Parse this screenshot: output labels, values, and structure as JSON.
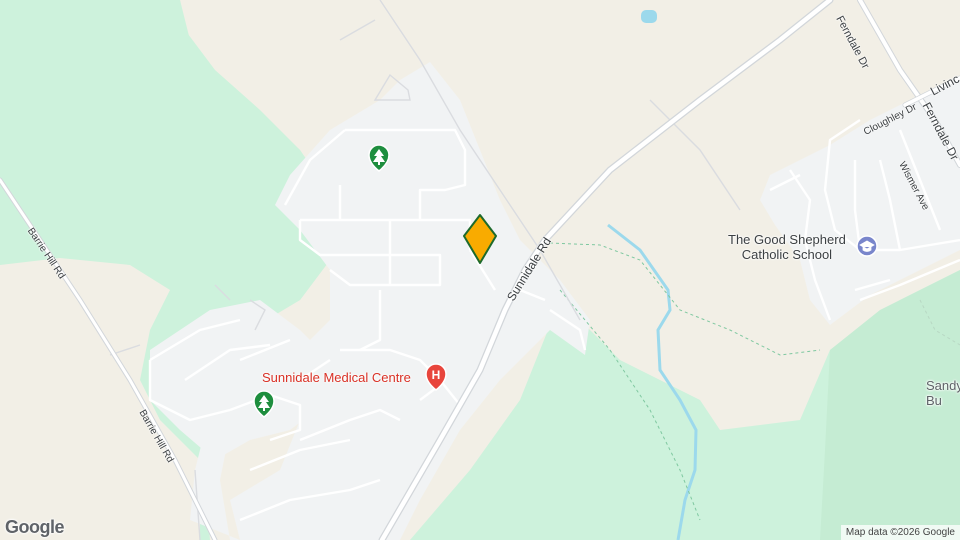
{
  "map": {
    "roads": {
      "ferndale_dr": "Ferndale Dr",
      "livingstone": "Livinc",
      "cloughley_dr": "Cloughley Dr",
      "wismer_ave": "Wismer Ave",
      "sunnidale_rd": "Sunnidale Rd",
      "barrie_hill_rd_top": "Barrie Hill Rd",
      "barrie_hill_rd_bottom": "Barrie Hill Rd"
    },
    "pois": {
      "school": "The Good Shepherd\nCatholic School",
      "medical": "Sunnidale Medical Centre",
      "sandy": "Sandy\nBu"
    },
    "icons": {
      "park_1": "tree-icon",
      "park_2": "tree-icon",
      "hospital": "hospital-icon",
      "school": "graduation-cap-icon",
      "marker": "location-marker-icon"
    },
    "colors": {
      "land": "#f2efe6",
      "park": "#cdf2dc",
      "urban": "#f1f3f4",
      "road": "#ffffff",
      "water": "#9cd9ec",
      "marker": "#f9ab00",
      "marker_border": "#1e6a2b",
      "medical_text": "#d93025",
      "hospital_icon": "#e8453c",
      "park_icon": "#1e8e3e",
      "school_icon": "#7986cb"
    }
  },
  "footer": {
    "logo": "Google",
    "attribution": "Map data ©2026 Google"
  }
}
